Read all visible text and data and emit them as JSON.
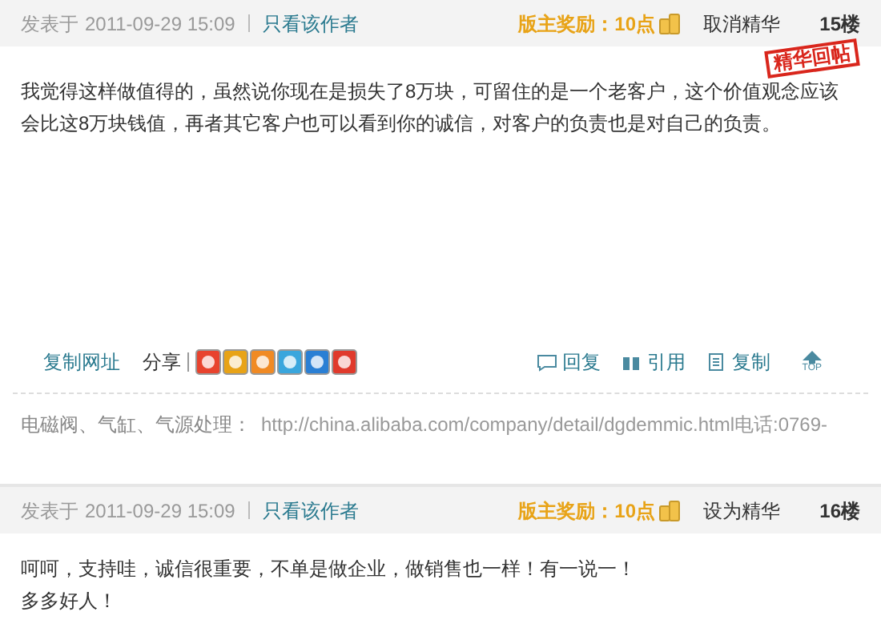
{
  "posts": [
    {
      "posted_label": "发表于",
      "date": "2011-09-29 15:09",
      "author_only": "只看该作者",
      "reward": "版主奖励：10点",
      "essence_action": "取消精华",
      "floor": "15楼",
      "stamp": "精华回帖",
      "body": [
        "我觉得这样做值得的，虽然说你现在是损失了8万块，可留住的是一个老客户，这个价值观念应该",
        "会比这8万块钱值，再者其它客户也可以看到你的诚信，对客户的负责也是对自己的负责。"
      ],
      "actions": {
        "copy_link": "复制网址",
        "share_label": "分享",
        "reply": "回复",
        "quote": "引用",
        "copy": "复制",
        "top": "TOP"
      },
      "signature": {
        "label": "电磁阀、气缸、气源处理：",
        "link": "http://china.alibaba.com/company/detail/dgdemmic.html电话:0769-"
      }
    },
    {
      "posted_label": "发表于",
      "date": "2011-09-29 15:09",
      "author_only": "只看该作者",
      "reward": "版主奖励：10点",
      "essence_action": "设为精华",
      "floor": "16楼",
      "body": [
        "呵呵，支持哇，诚信很重要，不单是做企业，做销售也一样！有一说一！",
        "多多好人！"
      ]
    }
  ]
}
